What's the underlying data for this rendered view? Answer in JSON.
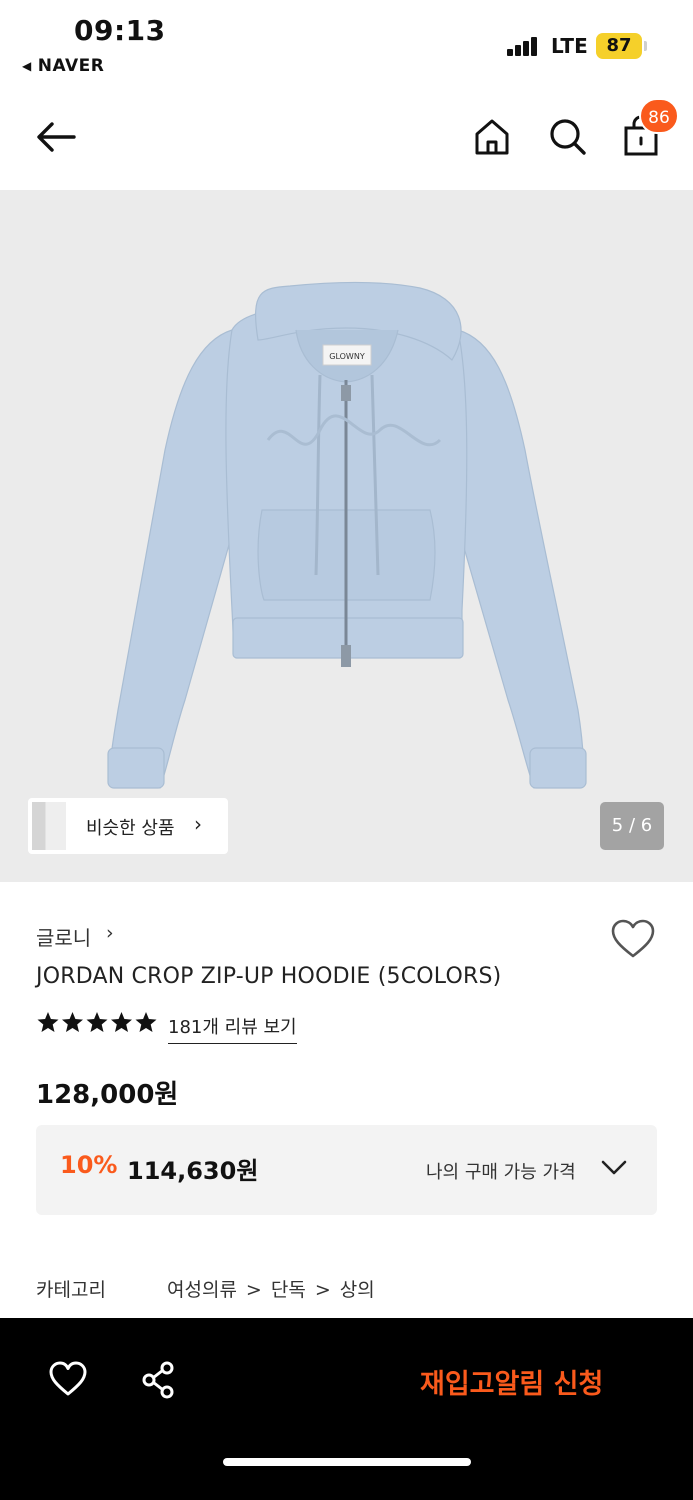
{
  "status_bar": {
    "time": "09:13",
    "back_app": "NAVER",
    "network": "LTE",
    "battery": "87",
    "icons": [
      "signal-icon",
      "battery-icon"
    ]
  },
  "header": {
    "icons": [
      "back-arrow-icon",
      "home-icon",
      "search-icon",
      "shopping-bag-icon"
    ],
    "cart_count": "86"
  },
  "gallery": {
    "similar_label": "비슷한 상품",
    "similar_chevron": "›",
    "page_counter": "5 / 6",
    "tag_text": "GLOWNY",
    "image_colors": {
      "background": "#ebebeb",
      "hoodie": "#bccee3"
    }
  },
  "product": {
    "brand": "글로니",
    "brand_chevron": "›",
    "name": "JORDAN CROP ZIP-UP HOODIE (5COLORS)",
    "rating": 5,
    "review_link": "181개 리뷰 보기",
    "price": "128,000원",
    "discount": {
      "rate": "10%",
      "price": "114,630원",
      "label": "나의 구매 가능 가격"
    },
    "category": {
      "label": "카테고리",
      "path": [
        "여성의류",
        "단독",
        "상의"
      ],
      "separator": ">"
    }
  },
  "bottom_bar": {
    "restock_label": "재입고알림 신청",
    "icons": [
      "heart-icon",
      "share-icon"
    ]
  },
  "colors": {
    "accent": "#fa5a1c",
    "text": "#111111",
    "bottom_bar": "#000000"
  }
}
